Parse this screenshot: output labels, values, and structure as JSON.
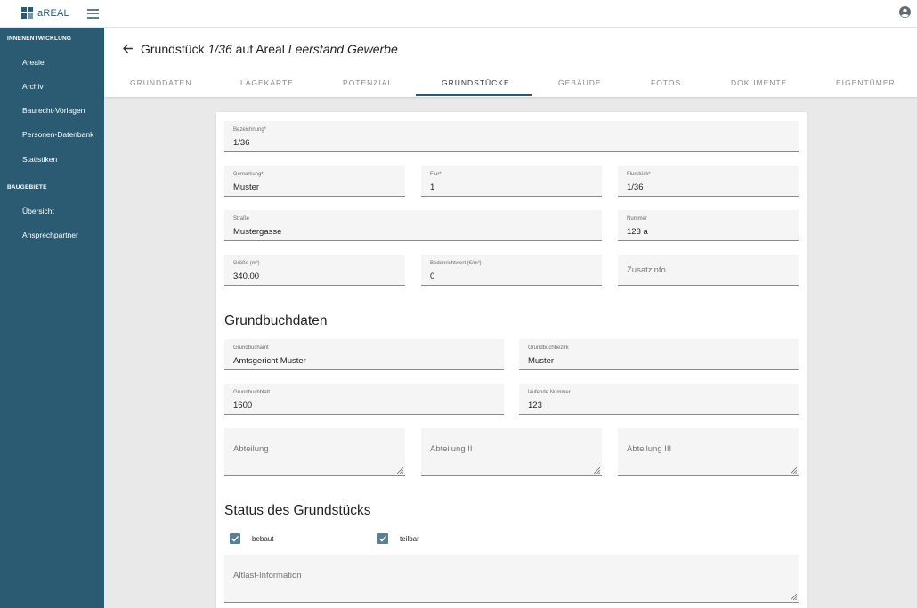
{
  "app": {
    "name": "aREAL"
  },
  "icons": {
    "menu": "hamburger-icon",
    "user": "user-circle-icon",
    "back": "arrow-left-icon",
    "checkbox": "check-icon",
    "resize": "resize-handle-icon"
  },
  "colors": {
    "sidebar": "#2a5b73",
    "accent": "#2a5b73",
    "checkbox": "#5a7f94"
  },
  "sidebar": {
    "sections": [
      {
        "heading": "INNENENTWICKLUNG",
        "items": [
          "Areale",
          "Archiv",
          "Baurecht-Vorlagen",
          "Personen-Datenbank",
          "Statistiken"
        ]
      },
      {
        "heading": "BAUGEBIETE",
        "items": [
          "Übersicht",
          "Ansprechpartner"
        ]
      }
    ]
  },
  "header": {
    "title_prefix": "Grundstück ",
    "title_id": "1/36",
    "title_mid": " auf Areal ",
    "title_area": "Leerstand Gewerbe",
    "tabs": [
      "GRUNDDATEN",
      "LAGEKARTE",
      "POTENZIAL",
      "GRUNDSTÜCKE",
      "GEBÄUDE",
      "FOTOS",
      "DOKUMENTE",
      "EIGENTÜMER"
    ],
    "active_tab": "GRUNDSTÜCKE"
  },
  "form": {
    "bezeichnung": {
      "label": "Bezeichnung*",
      "value": "1/36"
    },
    "gemarkung": {
      "label": "Gemarkung*",
      "value": "Muster"
    },
    "flur": {
      "label": "Flur*",
      "value": "1"
    },
    "flurstueck": {
      "label": "Flurstück*",
      "value": "1/36"
    },
    "strasse": {
      "label": "Straße",
      "value": "Mustergasse"
    },
    "nummer": {
      "label": "Nummer",
      "value": "123 a"
    },
    "groesse": {
      "label": "Größe (m²)",
      "value": "340.00"
    },
    "bodenrichtwert": {
      "label": "Bodenrichtwert (€/m²)",
      "value": "0"
    },
    "zusatzinfo": {
      "placeholder": "Zusatzinfo"
    }
  },
  "grundbuch": {
    "heading": "Grundbuchdaten",
    "grundbuchamt": {
      "label": "Grundbuchamt",
      "value": "Amtsgericht Muster"
    },
    "grundbuchbezirk": {
      "label": "Grundbuchbezirk",
      "value": "Muster"
    },
    "grundbuchblatt": {
      "label": "Grundbuchblatt",
      "value": "1600"
    },
    "laufende_nummer": {
      "label": "laufende Nummer",
      "value": "123"
    },
    "abteilung1": {
      "placeholder": "Abteilung I"
    },
    "abteilung2": {
      "placeholder": "Abteilung II"
    },
    "abteilung3": {
      "placeholder": "Abteilung III"
    }
  },
  "status": {
    "heading": "Status des Grundstücks",
    "bebaut": {
      "label": "bebaut",
      "checked": true
    },
    "teilbar": {
      "label": "teilbar",
      "checked": true
    },
    "altlast": {
      "placeholder": "Altlast-Information"
    }
  }
}
